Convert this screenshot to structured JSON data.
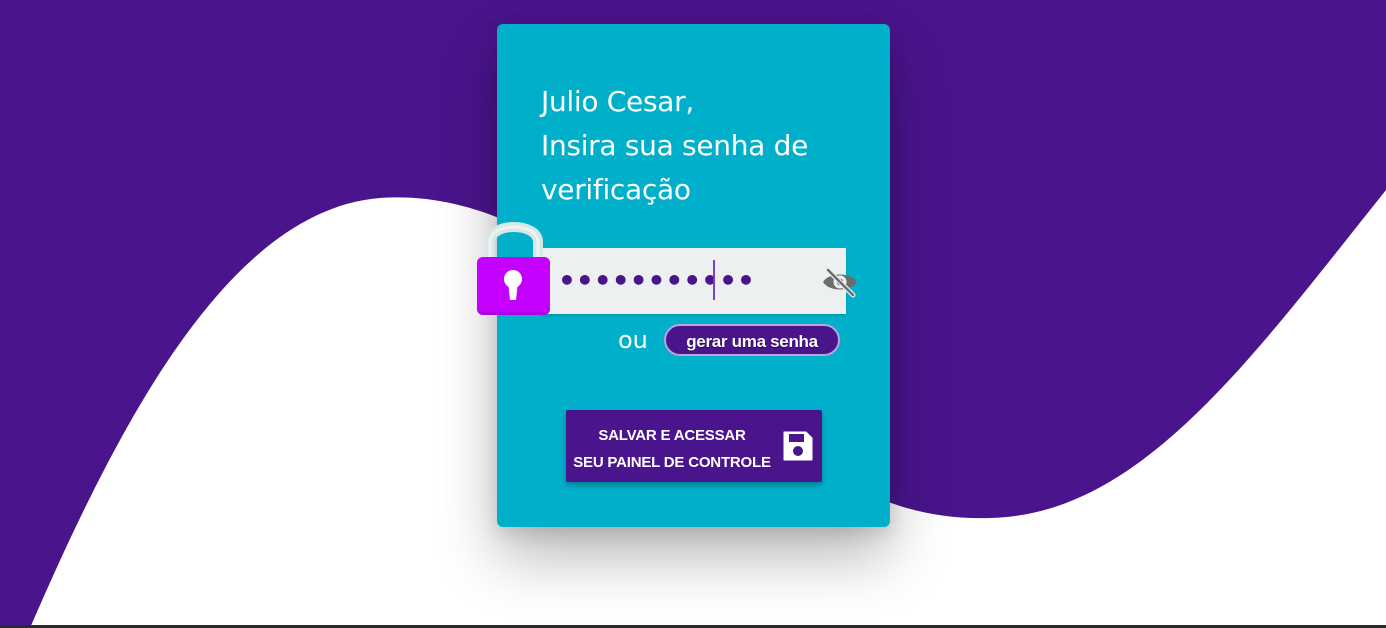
{
  "heading": {
    "line1": "Julio Cesar,",
    "line2": "Insira sua senha de",
    "line3": "verificação"
  },
  "password": {
    "value": "•••••••••••"
  },
  "icons": {
    "lock": "padlock-icon",
    "visibility": "eye-off-icon",
    "save": "floppy-disk-icon"
  },
  "alternative": {
    "or_label": "ou",
    "generate_label": "gerar uma senha"
  },
  "save_button": {
    "line1": "SALVAR E ACESSAR",
    "line2": "SEU PAINEL DE CONTROLE"
  },
  "colors": {
    "background_purple": "#4a148c",
    "card": "#00b0ca",
    "lock_body": "#c400ff",
    "input_bg": "#ecf0f1"
  }
}
